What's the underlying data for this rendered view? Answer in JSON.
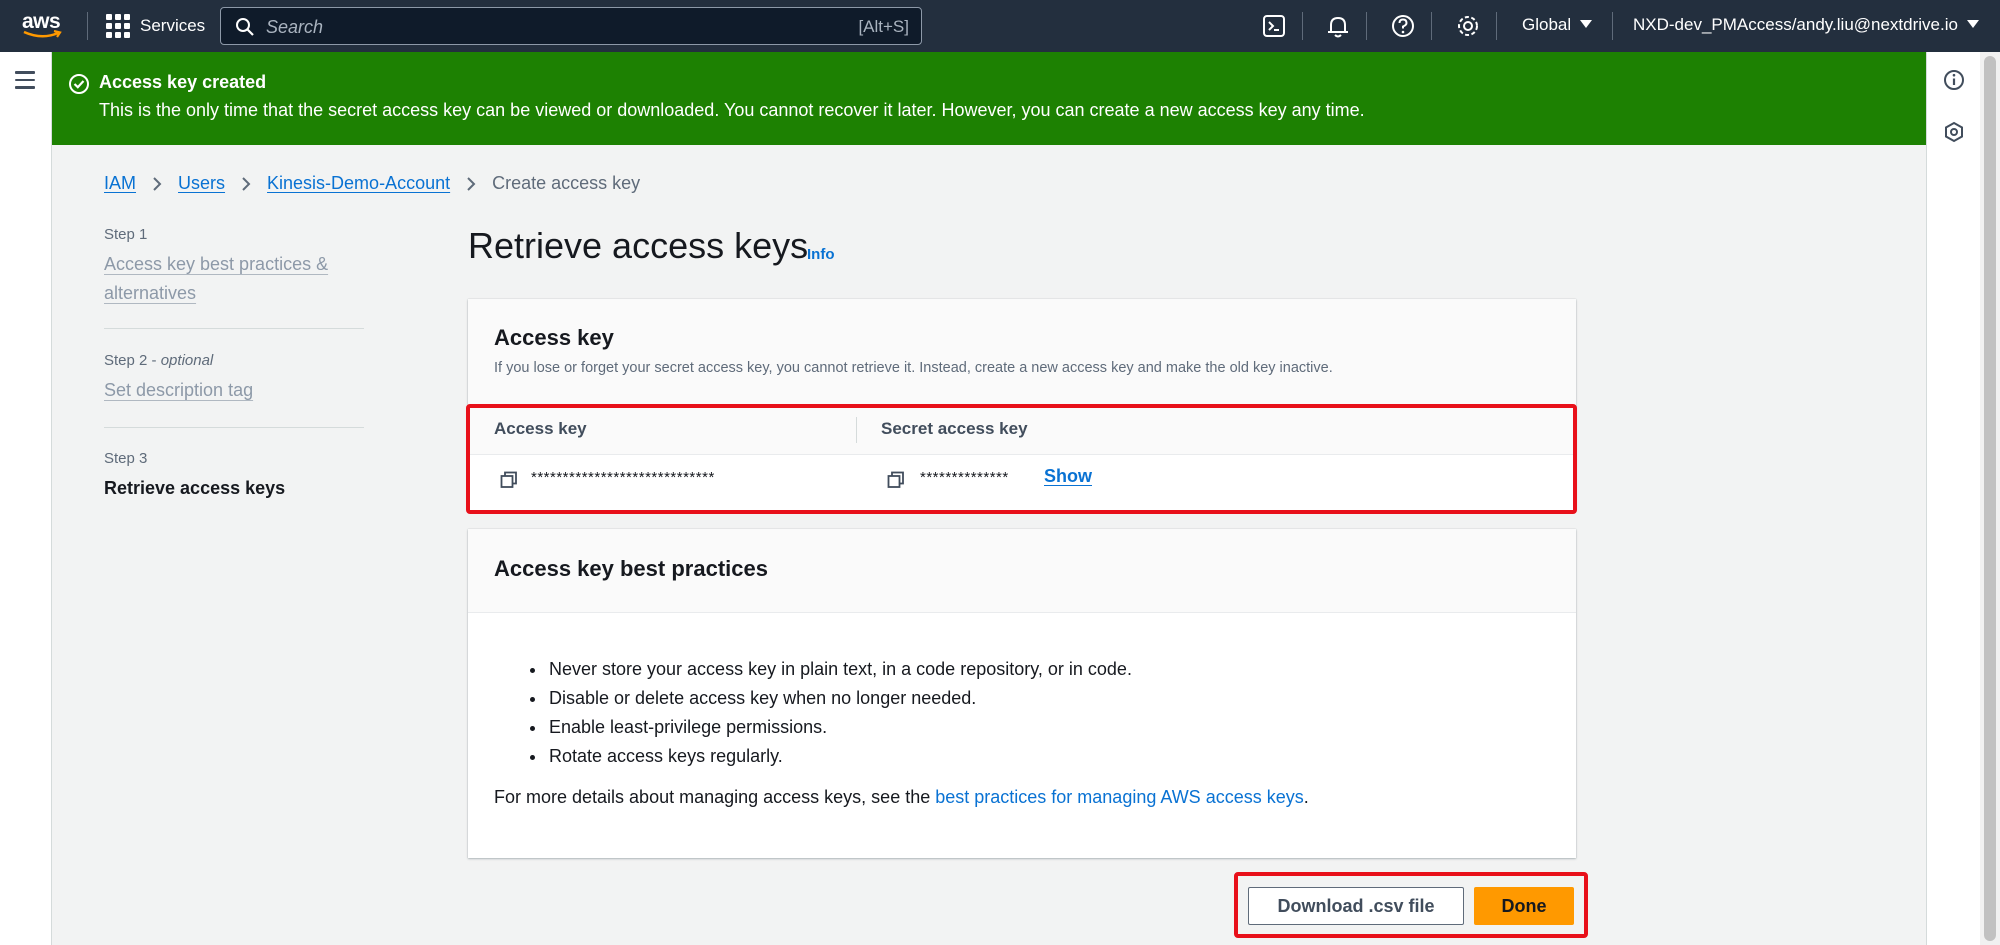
{
  "topnav": {
    "logo_text": "aws",
    "services_label": "Services",
    "search_placeholder": "Search",
    "search_shortcut": "[Alt+S]",
    "icons": [
      "cloudshell-icon",
      "bell-icon",
      "help-icon",
      "gear-icon"
    ],
    "region": "Global",
    "account": "NXD-dev_PMAccess/andy.liu@nextdrive.io"
  },
  "flash": {
    "title": "Access key created",
    "message": "This is the only time that the secret access key can be viewed or downloaded. You cannot recover it later. However, you can create a new access key any time.",
    "color": "#1d8102"
  },
  "breadcrumb": {
    "items": [
      "IAM",
      "Users",
      "Kinesis-Demo-Account"
    ],
    "current": "Create access key"
  },
  "steps": [
    {
      "label": "Step 1",
      "title": "Access key best practices & alternatives"
    },
    {
      "label": "Step 2",
      "optional": "optional",
      "title": "Set description tag"
    },
    {
      "label": "Step 3",
      "title": "Retrieve access keys"
    }
  ],
  "main": {
    "title": "Retrieve access keys",
    "info_link": "Info"
  },
  "access_key_panel": {
    "title": "Access key",
    "description": "If you lose or forget your secret access key, you cannot retrieve it. Instead, create a new access key and make the old key inactive.",
    "columns": [
      "Access key",
      "Secret access key"
    ],
    "access_key_value": "*****************************",
    "secret_key_value": "**************",
    "show_label": "Show"
  },
  "best_practices": {
    "title": "Access key best practices",
    "items": [
      "Never store your access key in plain text, in a code repository, or in code.",
      "Disable or delete access key when no longer needed.",
      "Enable least-privilege permissions.",
      "Rotate access keys regularly."
    ],
    "more_prefix": "For more details about managing access keys, see the ",
    "more_link": "best practices for managing AWS access keys",
    "more_suffix": "."
  },
  "actions": {
    "download_label": "Download .csv file",
    "done_label": "Done",
    "accent": "#ff9900"
  }
}
